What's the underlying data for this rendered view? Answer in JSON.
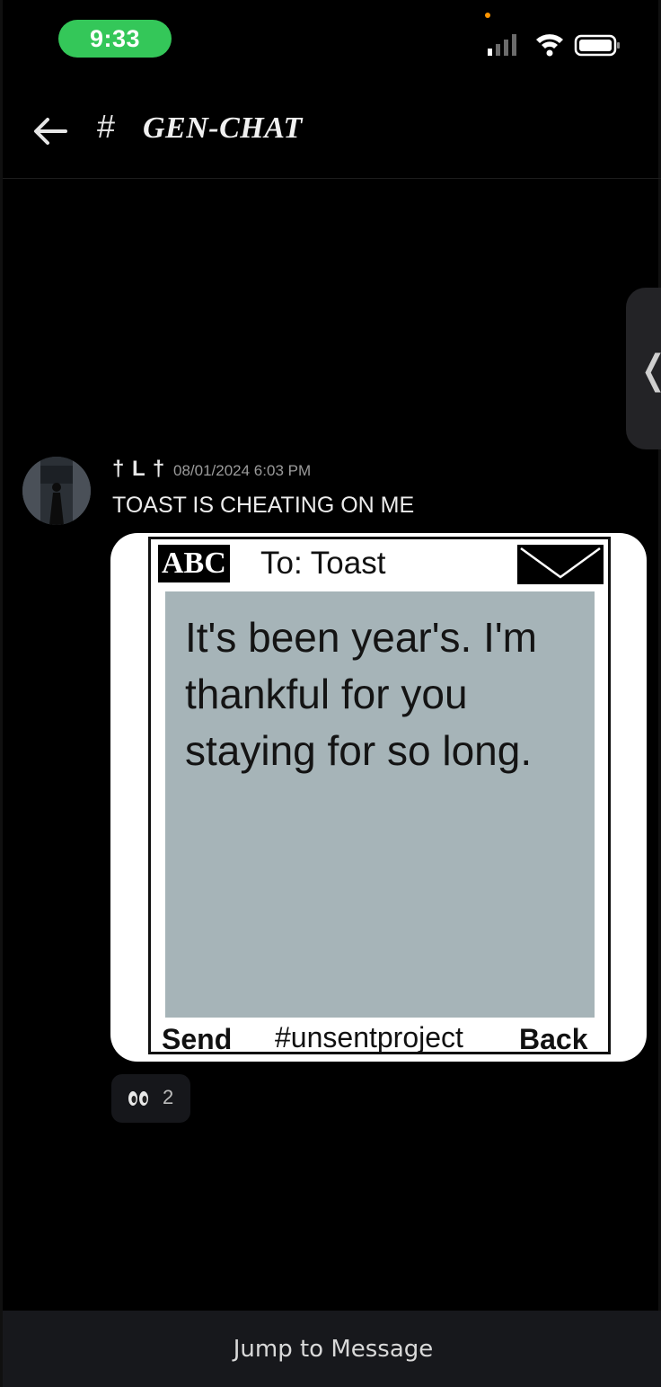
{
  "status_bar": {
    "time": "9:33",
    "time_pill_color": "#34c759",
    "icons": [
      "signal-icon",
      "wifi-icon",
      "battery-icon"
    ]
  },
  "header": {
    "back_icon": "arrow-left-icon",
    "hash": "#",
    "channel_name": "GEN-CHAT"
  },
  "side_drawer": {
    "icon": "chevron-left-icon",
    "glyph": "❬"
  },
  "message": {
    "username": "† L †",
    "timestamp": "08/01/2024 6:03 PM",
    "text": "TOAST IS CHEATING ON ME",
    "attachment": {
      "abc_label": "ABC",
      "to_label": "To: Toast",
      "envelope_icon": "envelope-icon",
      "body": "It's been year's. I'm thankful for you staying for so long.",
      "send_label": "Send",
      "tag": "#unsentproject",
      "back_label": "Back",
      "screen_color": "#a6b4b8"
    },
    "reaction": {
      "emoji_icon": "eyes-emoji-icon",
      "count": "2"
    }
  },
  "bottom_bar": {
    "label": "Jump to Message"
  }
}
